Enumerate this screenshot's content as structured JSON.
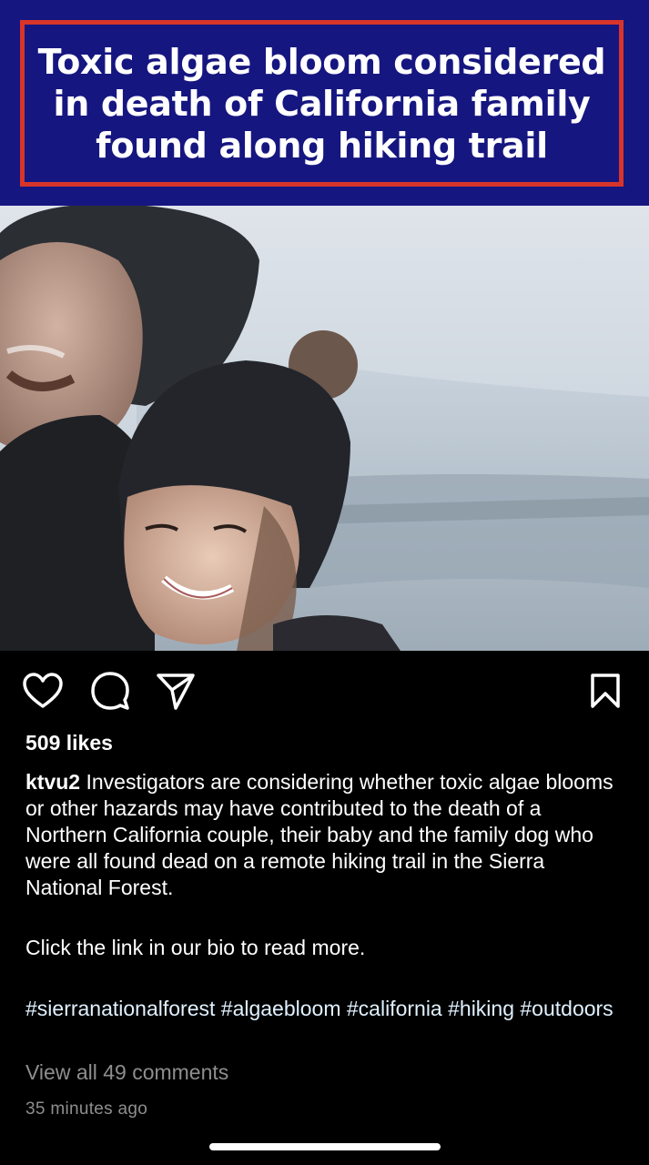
{
  "post": {
    "headline": "Toxic algae bloom considered in death of California family found along hiking trail",
    "likes": "509 likes",
    "username": "ktvu2",
    "caption": " Investigators are considering whether toxic algae blooms or other hazards may have contributed to the death of a Northern California couple, their baby and the family dog who were all found dead on a remote hiking trail in the Sierra National Forest.",
    "caption_link_note": "Click the link in our bio to read more.",
    "hashtags": "#sierranationalforest #algaebloom #california #hiking #outdoors",
    "view_comments": "View all 49 comments",
    "timestamp": "35 minutes ago"
  },
  "actions": {
    "like_icon": "heart-icon",
    "comment_icon": "comment-icon",
    "share_icon": "send-icon",
    "save_icon": "bookmark-icon"
  },
  "colors": {
    "banner_bg": "#161680",
    "banner_border": "#d8352a",
    "background": "#000000",
    "muted_text": "#8e8e8e",
    "hashtag_text": "#e0f1ff"
  }
}
